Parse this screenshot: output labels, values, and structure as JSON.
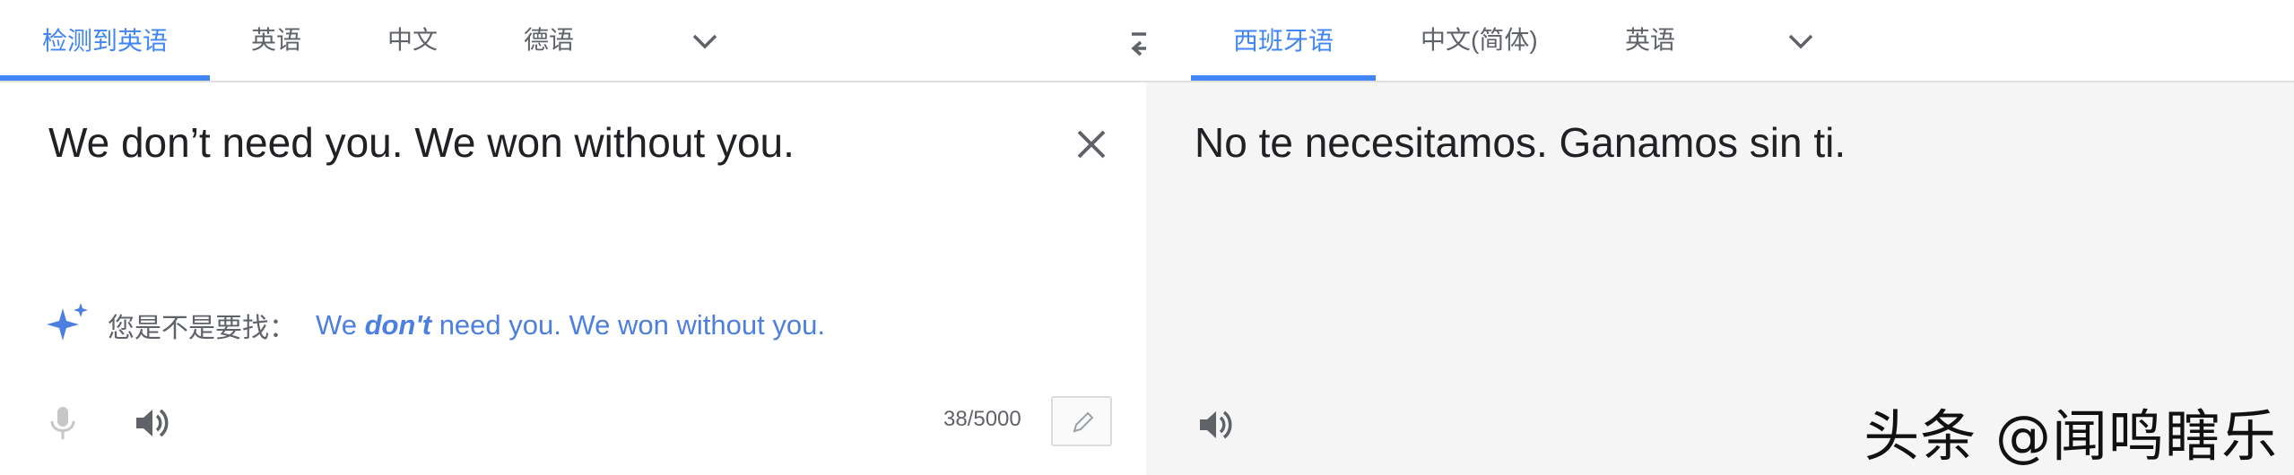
{
  "source": {
    "tabs": [
      "检测到英语",
      "英语",
      "中文",
      "德语"
    ],
    "text": "We don’t need you. We won without you.",
    "suggestion_label": "您是不是要找：",
    "suggestion": {
      "pre": "We ",
      "bold": "don't",
      "post": " need you. We won without you."
    },
    "char_count": "38/5000",
    "icons": [
      "sparkle-icon",
      "mic-icon",
      "speaker-icon",
      "close-icon",
      "pencil-icon",
      "chevron-down-icon"
    ]
  },
  "target": {
    "tabs": [
      "西班牙语",
      "中文(简体)",
      "英语"
    ],
    "text": "No te necesitamos. Ganamos sin ti.",
    "icons": [
      "speaker-icon",
      "chevron-down-icon"
    ]
  },
  "watermark": "头条 @闻鸣瞎乐",
  "colors": {
    "accent": "#4285f4",
    "link": "#4d7fe0",
    "text": "#202124",
    "muted": "#5f6368",
    "target_bg": "#f5f5f5"
  }
}
